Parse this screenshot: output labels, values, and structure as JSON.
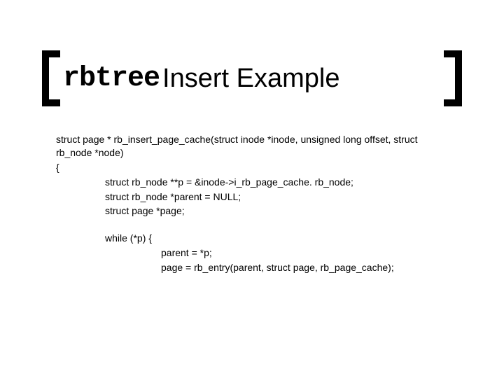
{
  "title": {
    "mono": "rbtree",
    "rest": " Insert Example"
  },
  "code": {
    "signature": "struct page * rb_insert_page_cache(struct inode *inode, unsigned long offset, struct rb_node *node)",
    "open_brace": "{",
    "decl1": "struct rb_node **p = &inode->i_rb_page_cache. rb_node;",
    "decl2": "struct rb_node *parent = NULL;",
    "decl3": "struct page *page;",
    "while_line": "while (*p) {",
    "body1": "parent = *p;",
    "body2": "page = rb_entry(parent, struct page, rb_page_cache);"
  }
}
